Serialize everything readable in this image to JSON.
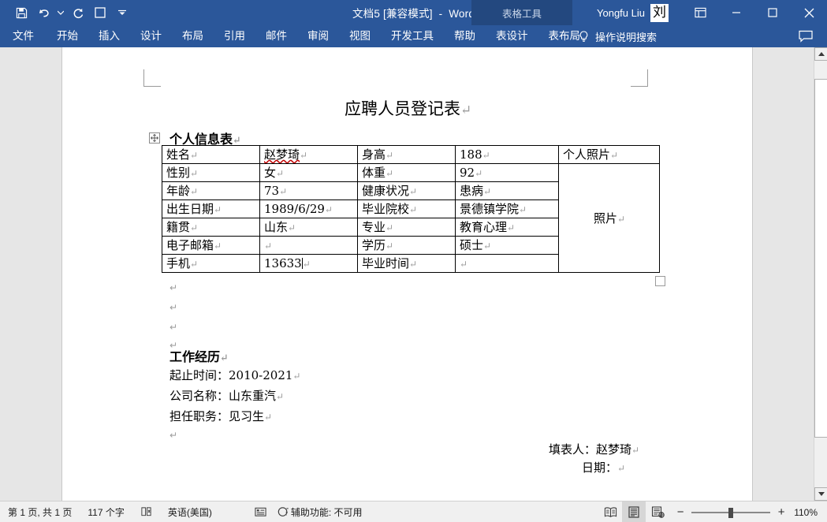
{
  "window": {
    "title": "文档5 [兼容模式]  -  Word",
    "user_name": "Yongfu Liu",
    "avatar_glyph": "刘",
    "quick_access": [
      {
        "name": "save",
        "icon": "save-icon"
      },
      {
        "name": "undo",
        "icon": "undo-icon"
      },
      {
        "name": "redo",
        "icon": "redo-icon"
      },
      {
        "name": "touch-mode",
        "icon": "square-icon"
      },
      {
        "name": "customize-qat",
        "icon": "chevron-down-icon"
      }
    ],
    "buttons": {
      "ribbon_display": "ribbon-display-options",
      "minimize": "–",
      "restore": "▢",
      "close": "✕"
    }
  },
  "contextual_tools": {
    "label": "表格工具"
  },
  "ribbon": {
    "tabs": [
      {
        "label": "文件",
        "active": false
      },
      {
        "label": "开始",
        "active": false
      },
      {
        "label": "插入",
        "active": false
      },
      {
        "label": "设计",
        "active": false
      },
      {
        "label": "布局",
        "active": false
      },
      {
        "label": "引用",
        "active": false
      },
      {
        "label": "邮件",
        "active": false
      },
      {
        "label": "审阅",
        "active": false
      },
      {
        "label": "视图",
        "active": false
      },
      {
        "label": "开发工具",
        "active": false
      },
      {
        "label": "帮助",
        "active": false
      },
      {
        "label": "表设计",
        "active": false
      },
      {
        "label": "表布局",
        "active": false
      }
    ],
    "tell_me": "操作说明搜索",
    "comments_icon": "comment-icon"
  },
  "document": {
    "title_line": "应聘人员登记表",
    "heading_personal": "个人信息表",
    "heading_work": "工作经历",
    "table": {
      "rows": [
        [
          "姓名",
          "赵梦琦",
          "身高",
          "188",
          "个人照片"
        ],
        [
          "性别",
          "女",
          "体重",
          "92",
          ""
        ],
        [
          "年龄",
          "73",
          "健康状况",
          "患病",
          ""
        ],
        [
          "出生日期",
          "1989/6/29",
          "毕业院校",
          "景德镇学院",
          ""
        ],
        [
          "籍贯",
          "山东",
          "专业",
          "教育心理",
          ""
        ],
        [
          "电子邮箱",
          "",
          "学历",
          "硕士",
          ""
        ],
        [
          "手机",
          "13633",
          "毕业时间",
          "",
          ""
        ]
      ],
      "photo_cell_text": "照片",
      "misspelled_cell": "赵梦琦"
    },
    "work_lines": [
      "起止时间：2010-2021",
      "公司名称：山东重汽",
      "担任职务：见习生"
    ],
    "signature": {
      "filled_by": "填表人：赵梦琦",
      "date": "日期："
    },
    "pilcrow": "↵"
  },
  "status_bar": {
    "page_info": "第 1 页, 共 1 页",
    "word_count": "117 个字",
    "proofing_icon": "proofing-errors-icon",
    "language": "英语(美国)",
    "ime_icon": "input-method-icon",
    "accessibility": "辅助功能: 不可用",
    "views": [
      {
        "name": "read-mode",
        "icon": "read-mode-icon",
        "active": false
      },
      {
        "name": "print-layout",
        "icon": "print-layout-icon",
        "active": true
      },
      {
        "name": "web-layout",
        "icon": "web-layout-icon",
        "active": false
      }
    ],
    "zoom_out": "−",
    "zoom_in": "+",
    "zoom_level": "110%"
  },
  "colors": {
    "title_bar": "#2b579a",
    "contextual_tab": "#23487f",
    "workspace": "#e6e6e6",
    "page": "#ffffff",
    "status_bar": "#f0f0f0",
    "misspell_underline": "#c00000"
  }
}
